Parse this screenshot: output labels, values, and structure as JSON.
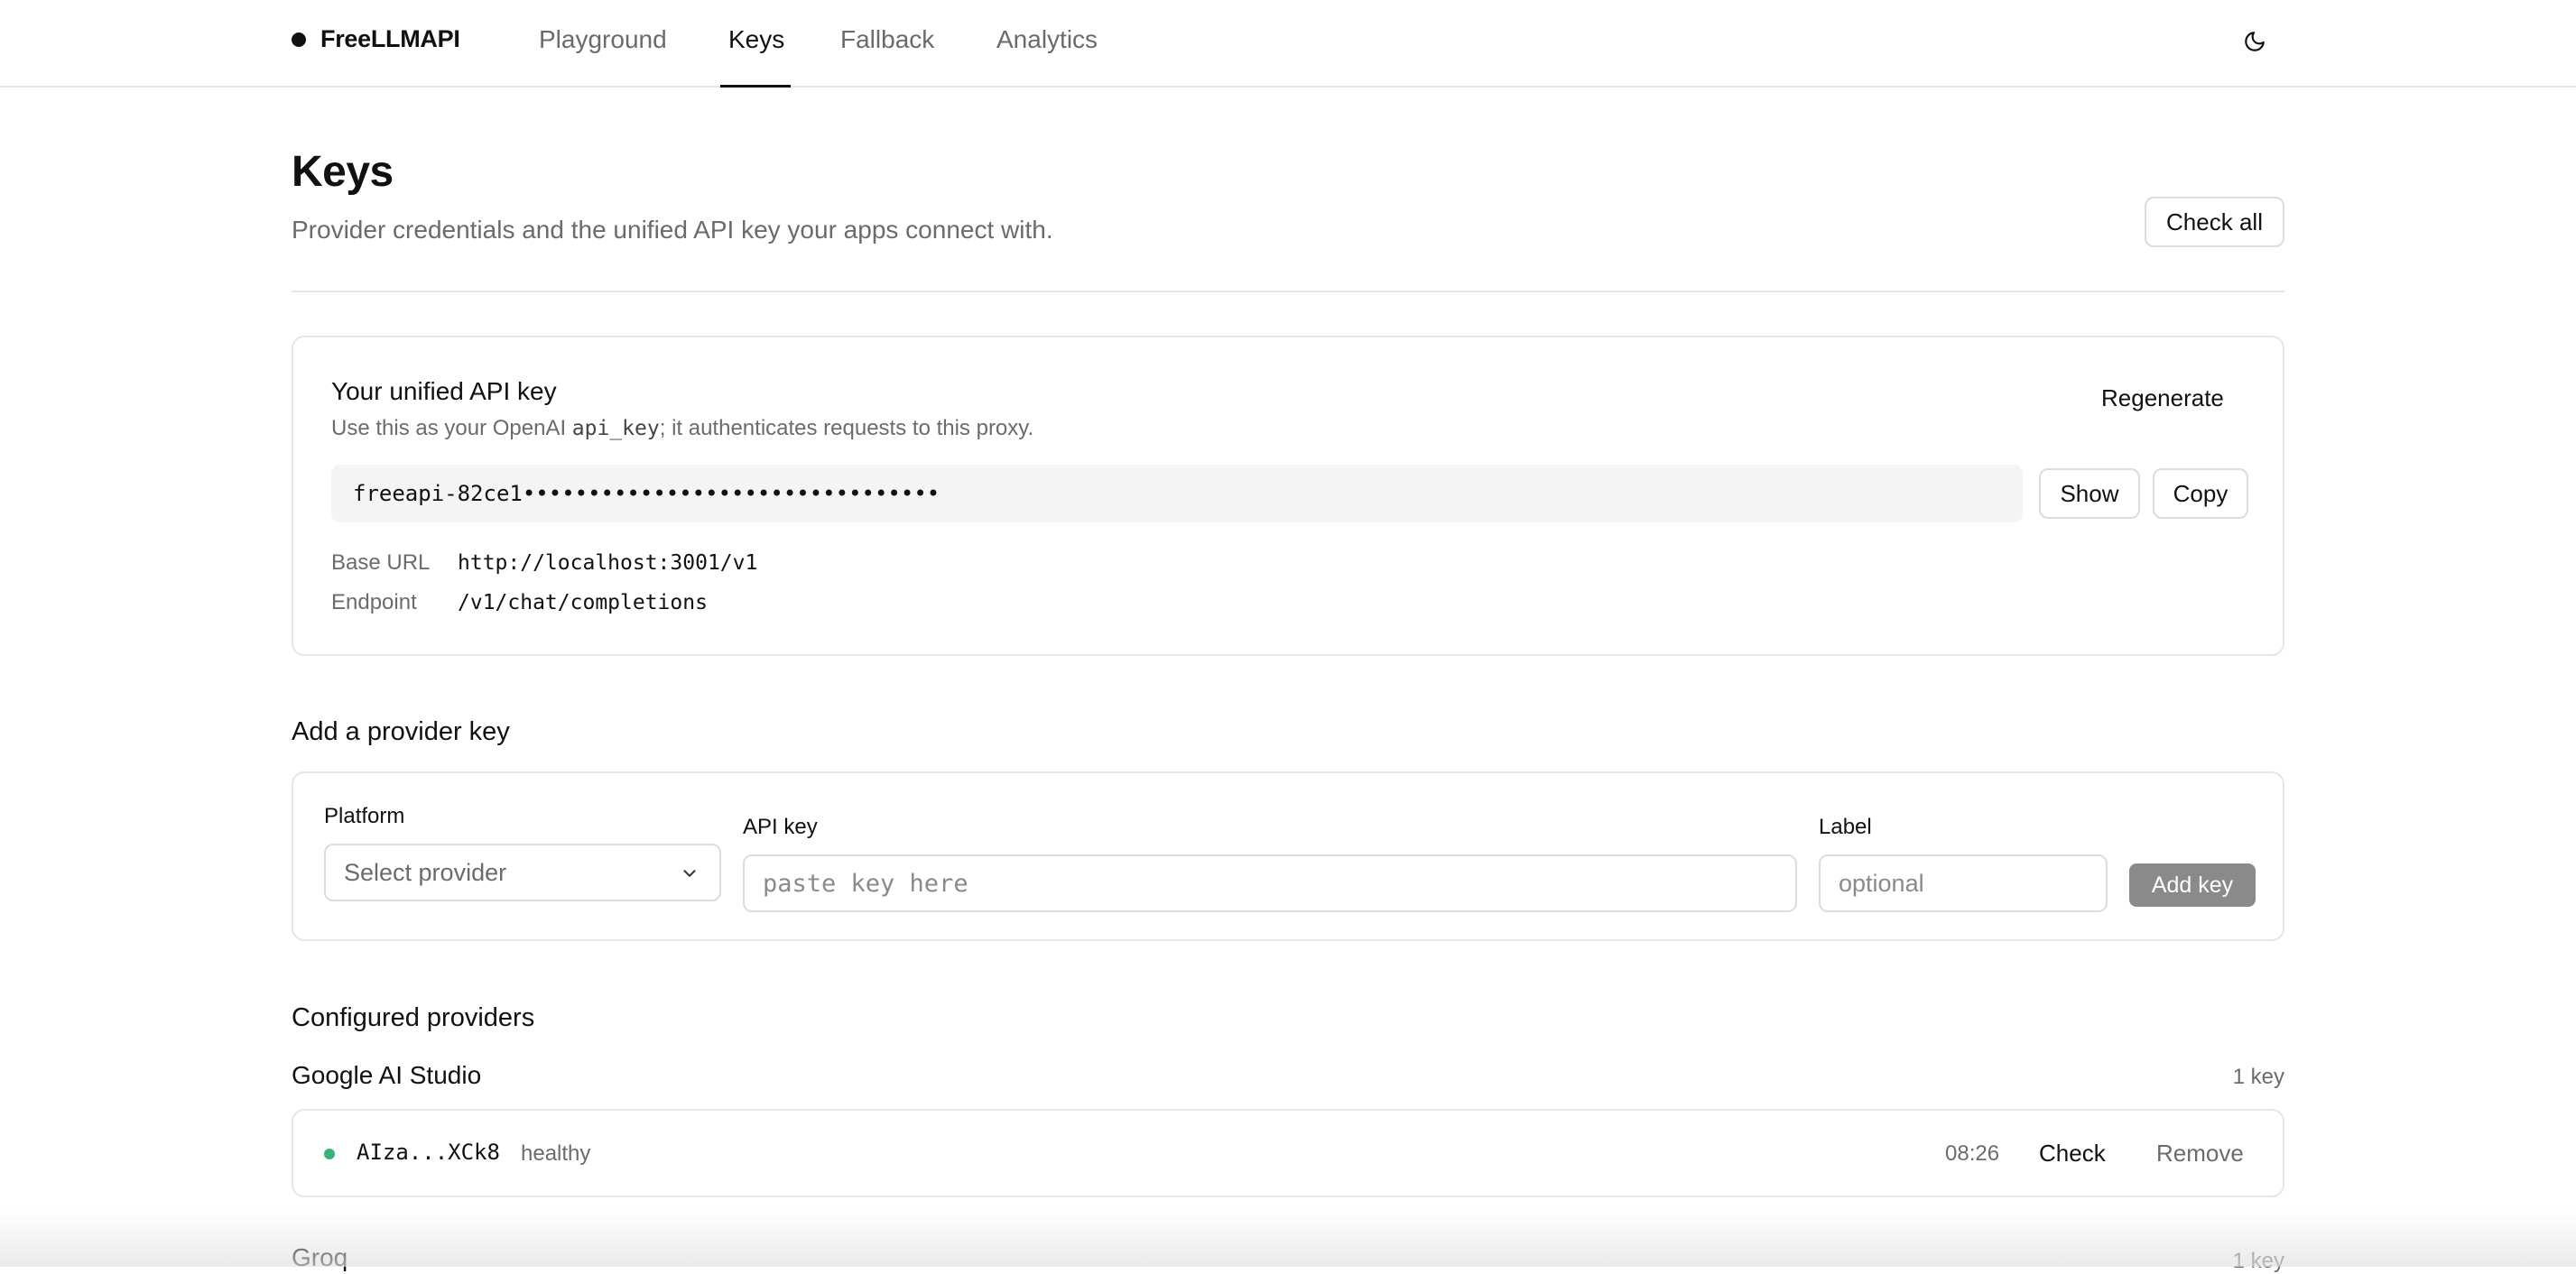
{
  "nav": {
    "brand": "FreeLLMAPI",
    "tabs": [
      {
        "label": "Playground",
        "active": false
      },
      {
        "label": "Keys",
        "active": true
      },
      {
        "label": "Fallback",
        "active": false
      },
      {
        "label": "Analytics",
        "active": false
      }
    ],
    "theme_icon": "moon-icon"
  },
  "header": {
    "title": "Keys",
    "subtitle": "Provider credentials and the unified API key your apps connect with.",
    "check_all_label": "Check all"
  },
  "unified_key": {
    "title": "Your unified API key",
    "desc_prefix": "Use this as your OpenAI ",
    "desc_code": "api_key",
    "desc_suffix": "; it authenticates requests to this proxy.",
    "regenerate_label": "Regenerate",
    "masked_key": "freeapi-82ce1••••••••••••••••••••••••••••••••",
    "show_label": "Show",
    "copy_label": "Copy",
    "base_url_label": "Base URL",
    "base_url_value": "http://localhost:3001/v1",
    "endpoint_label": "Endpoint",
    "endpoint_value": "/v1/chat/completions"
  },
  "add_provider": {
    "title": "Add a provider key",
    "platform_label": "Platform",
    "platform_placeholder": "Select provider",
    "api_key_label": "API key",
    "api_key_placeholder": "paste key here",
    "label_label": "Label",
    "label_placeholder": "optional",
    "add_button": "Add key"
  },
  "configured": {
    "title": "Configured providers",
    "providers": [
      {
        "name": "Google AI Studio",
        "count": "1 key",
        "keys": [
          {
            "masked": "AIza...XCk8",
            "status": "healthy",
            "status_color": "#34b47a",
            "time": "08:26",
            "check_label": "Check",
            "remove_label": "Remove"
          }
        ]
      },
      {
        "name": "Groq",
        "count": "1 key"
      }
    ]
  }
}
